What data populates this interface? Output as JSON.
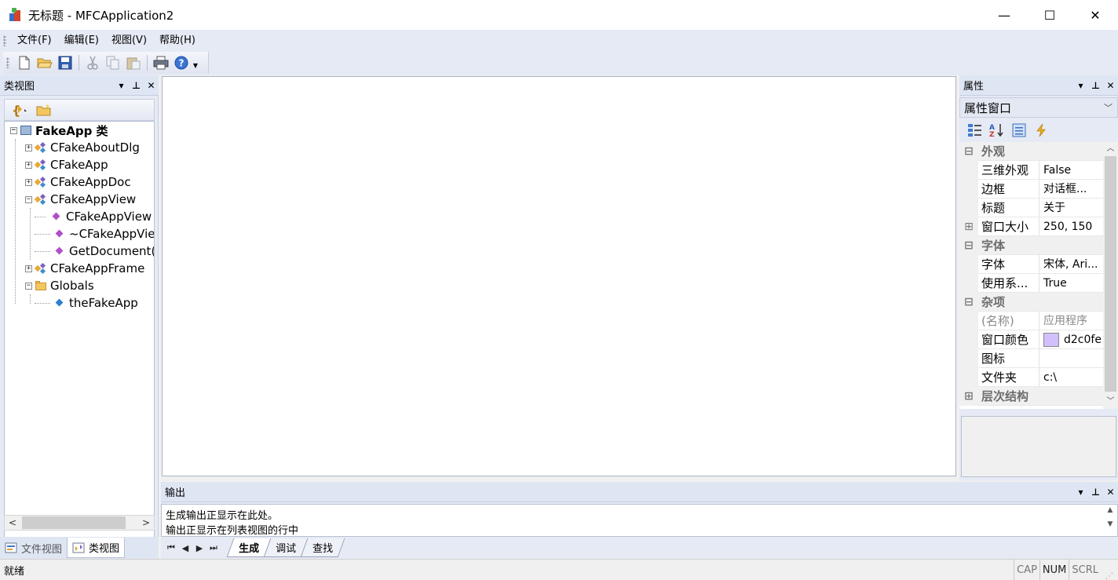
{
  "window": {
    "title": "无标题 - MFCApplication2",
    "minimize": "—",
    "maximize": "☐",
    "close": "✕"
  },
  "menu": [
    "文件(F)",
    "编辑(E)",
    "视图(V)",
    "帮助(H)"
  ],
  "class_view": {
    "title": "类视图",
    "tree": [
      {
        "label": "FakeApp 类",
        "kind": "root"
      },
      {
        "label": "CFakeAboutDlg",
        "kind": "class"
      },
      {
        "label": "CFakeApp",
        "kind": "class"
      },
      {
        "label": "CFakeAppDoc",
        "kind": "class"
      },
      {
        "label": "CFakeAppView",
        "kind": "class"
      },
      {
        "label": "CFakeAppView",
        "kind": "method"
      },
      {
        "label": "~CFakeAppView",
        "kind": "method"
      },
      {
        "label": "GetDocument()",
        "kind": "method"
      },
      {
        "label": "CFakeAppFrame",
        "kind": "class"
      },
      {
        "label": "Globals",
        "kind": "folder"
      },
      {
        "label": "theFakeApp",
        "kind": "global"
      }
    ],
    "tabs": [
      "文件视图",
      "类视图"
    ]
  },
  "output": {
    "title": "输出",
    "lines": [
      "生成输出正显示在此处。",
      "输出正显示在列表视图的行中"
    ],
    "tabs": [
      "生成",
      "调试",
      "查找"
    ]
  },
  "properties": {
    "title": "属性",
    "combo": "属性窗口",
    "rows": [
      {
        "type": "cat",
        "name": "外观",
        "sign": "⊟"
      },
      {
        "type": "prop",
        "name": "三维外观",
        "value": "False"
      },
      {
        "type": "prop",
        "name": "边框",
        "value": "对话框..."
      },
      {
        "type": "prop",
        "name": "标题",
        "value": "关于"
      },
      {
        "type": "prop",
        "name": "窗口大小",
        "value": "250, 150",
        "sign": "⊞"
      },
      {
        "type": "cat",
        "name": "字体",
        "sign": "⊟"
      },
      {
        "type": "prop",
        "name": "字体",
        "value": "宋体, Ari..."
      },
      {
        "type": "prop",
        "name": "使用系...",
        "value": "True"
      },
      {
        "type": "cat",
        "name": "杂项",
        "sign": "⊟"
      },
      {
        "type": "grey",
        "name": "(名称)",
        "value": "应用程序"
      },
      {
        "type": "color",
        "name": "窗口颜色",
        "value": "d2c0fe"
      },
      {
        "type": "prop",
        "name": "图标",
        "value": ""
      },
      {
        "type": "prop",
        "name": "文件夹",
        "value": "c:\\"
      },
      {
        "type": "cat",
        "name": "层次结构",
        "sign": "⊞"
      }
    ]
  },
  "status": {
    "text": "就绪",
    "cap": "CAP",
    "num": "NUM",
    "scrl": "SCRL"
  },
  "colors": {
    "window_color_swatch": "#d2c0fe"
  }
}
